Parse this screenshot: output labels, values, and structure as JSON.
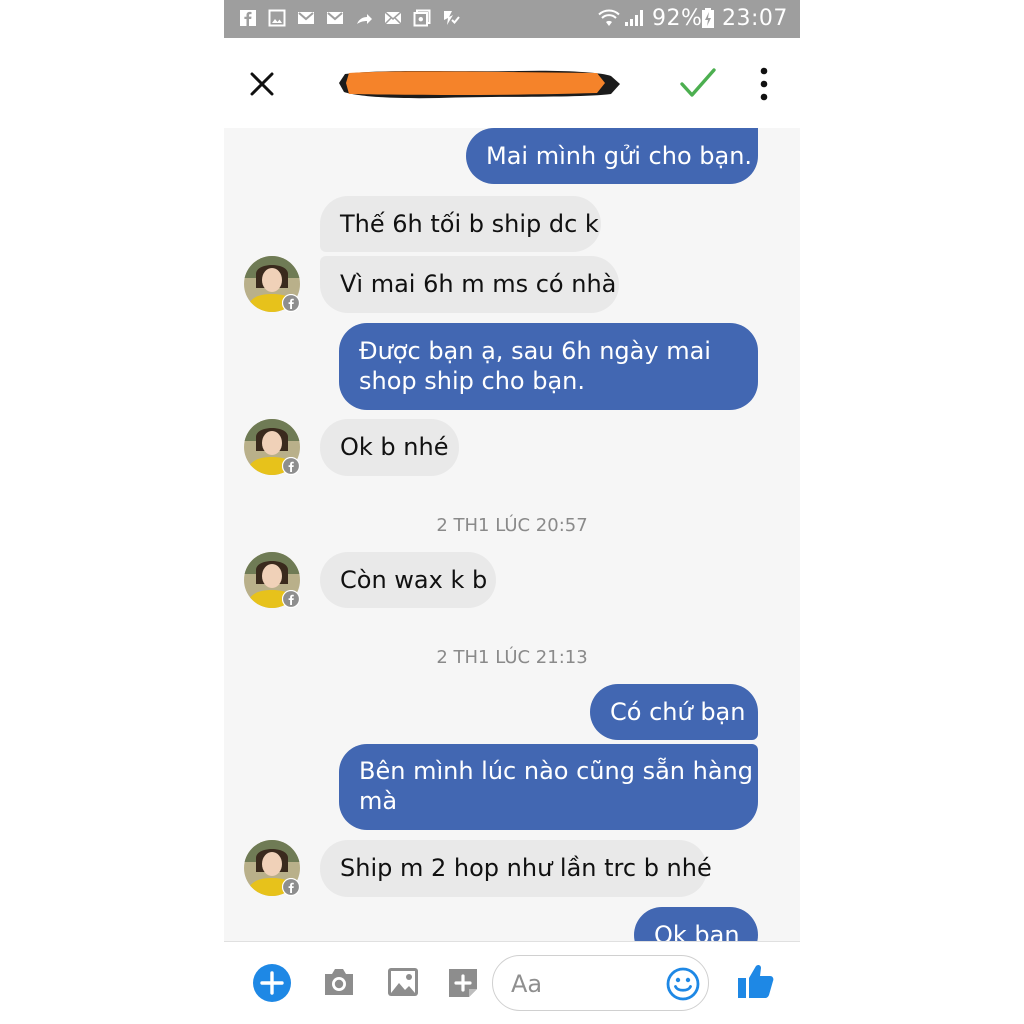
{
  "status_bar": {
    "battery": "92%",
    "time": "23:07",
    "icons": [
      "facebook-icon",
      "image-icon",
      "gmail-icon",
      "gmail-icon",
      "share-icon",
      "mail-icon",
      "gallery-icon",
      "download-check-icon",
      "wifi-icon",
      "signal-icon",
      "battery-charging-icon"
    ]
  },
  "header": {
    "close_icon": "close-icon",
    "contact_name_redacted": "",
    "confirm_icon": "check-icon",
    "more_icon": "more-vertical-icon",
    "accent_check": "#4caf50",
    "redaction_color": "#f5832a"
  },
  "messages": [
    {
      "id": "m1",
      "from": "me",
      "text": "Mai mình gửi cho bạn."
    },
    {
      "id": "m2",
      "from": "them",
      "text": "Thế 6h tối b ship dc k"
    },
    {
      "id": "m3",
      "from": "them",
      "text": "Vì mai 6h m ms có nhà",
      "avatar": true
    },
    {
      "id": "m4",
      "from": "me",
      "lines": [
        "Được bạn ạ, sau 6h ngày mai",
        "shop ship cho bạn."
      ]
    },
    {
      "id": "m5",
      "from": "them",
      "text": "Ok b nhé",
      "avatar": true
    },
    {
      "id": "t1",
      "type": "timestamp",
      "text": "2 TH1 LÚC 20:57"
    },
    {
      "id": "m6",
      "from": "them",
      "text": "Còn wax k b",
      "avatar": true
    },
    {
      "id": "t2",
      "type": "timestamp",
      "text": "2 TH1 LÚC 21:13"
    },
    {
      "id": "m7",
      "from": "me",
      "text": "Có chứ bạn"
    },
    {
      "id": "m8",
      "from": "me",
      "lines": [
        "Bên mình lúc nào cũng sẵn hàng",
        "mà"
      ]
    },
    {
      "id": "m9",
      "from": "them",
      "text": "Ship m 2 hop như lần trc b nhé",
      "avatar": true
    },
    {
      "id": "m10",
      "from": "me",
      "text": "Ok bạn"
    }
  ],
  "composer": {
    "placeholder": "Aa",
    "icons": [
      "plus-icon",
      "camera-icon",
      "image-icon",
      "sticker-icon",
      "emoji-icon",
      "like-icon"
    ]
  },
  "colors": {
    "outgoing": "#4267b2",
    "incoming": "#e9e9e9",
    "messenger_blue": "#1e88e5"
  }
}
